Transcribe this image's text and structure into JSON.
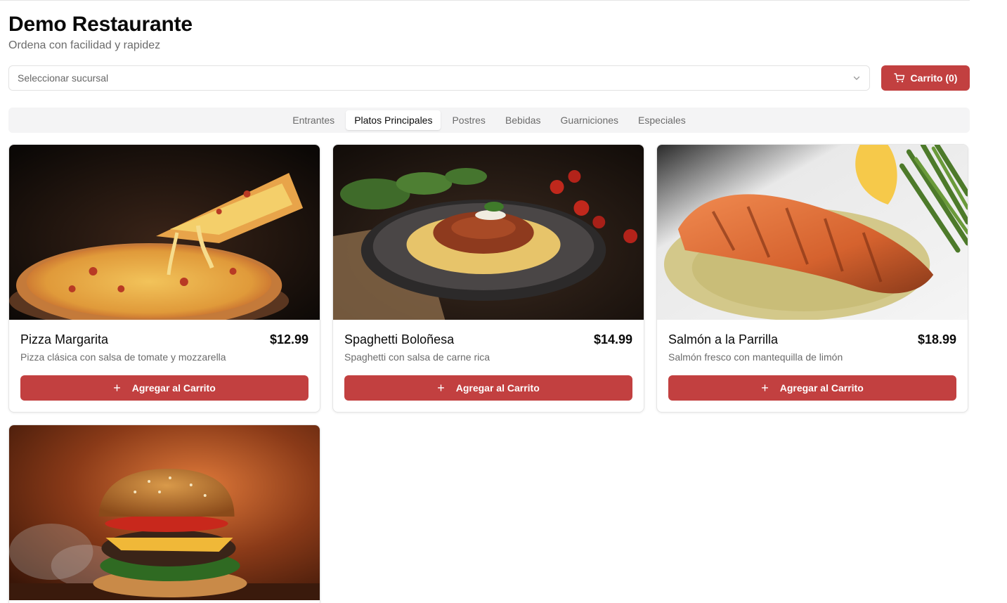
{
  "header": {
    "title": "Demo Restaurante",
    "subtitle": "Ordena con facilidad y rapidez"
  },
  "branch_select": {
    "placeholder": "Seleccionar sucursal"
  },
  "cart": {
    "label": "Carrito (0)"
  },
  "tabs": [
    {
      "label": "Entrantes",
      "active": false
    },
    {
      "label": "Platos Principales",
      "active": true
    },
    {
      "label": "Postres",
      "active": false
    },
    {
      "label": "Bebidas",
      "active": false
    },
    {
      "label": "Guarniciones",
      "active": false
    },
    {
      "label": "Especiales",
      "active": false
    }
  ],
  "products": [
    {
      "name": "Pizza Margarita",
      "price": "$12.99",
      "description": "Pizza clásica con salsa de tomate y mozzarella",
      "button": "Agregar al Carrito",
      "image": "pizza-photo"
    },
    {
      "name": "Spaghetti Boloñesa",
      "price": "$14.99",
      "description": "Spaghetti con salsa de carne rica",
      "button": "Agregar al Carrito",
      "image": "spaghetti-photo"
    },
    {
      "name": "Salmón a la Parrilla",
      "price": "$18.99",
      "description": "Salmón fresco con mantequilla de limón",
      "button": "Agregar al Carrito",
      "image": "salmon-photo"
    },
    {
      "name": "",
      "price": "",
      "description": "",
      "button": "",
      "image": "burger-photo"
    }
  ],
  "colors": {
    "accent": "#c24040",
    "muted_text": "#6b6b6b",
    "tab_bg": "#f4f4f5"
  }
}
